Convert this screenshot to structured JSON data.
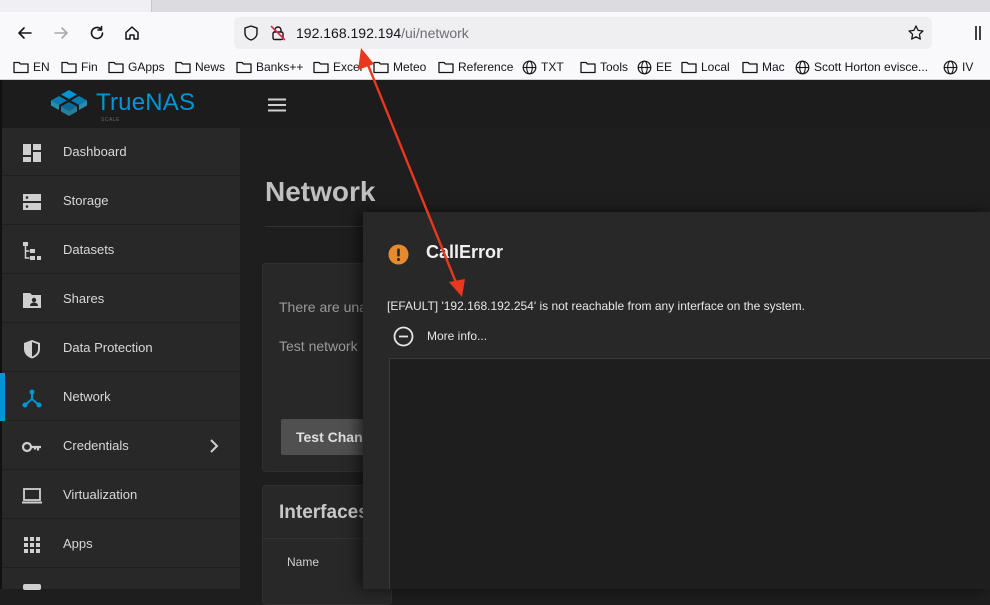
{
  "browser": {
    "url_host": "192.168.192.194",
    "url_path": "/ui/network",
    "bookmarks": [
      {
        "label": "EN",
        "icon": "folder-icon"
      },
      {
        "label": "Fin",
        "icon": "folder-icon"
      },
      {
        "label": "GApps",
        "icon": "folder-icon"
      },
      {
        "label": "News",
        "icon": "folder-icon"
      },
      {
        "label": "Banks++",
        "icon": "folder-icon"
      },
      {
        "label": "Excel",
        "icon": "folder-icon"
      },
      {
        "label": "Meteo",
        "icon": "folder-icon"
      },
      {
        "label": "Reference",
        "icon": "folder-icon"
      },
      {
        "label": "TXT",
        "icon": "globe-icon"
      },
      {
        "label": "Tools",
        "icon": "folder-icon"
      },
      {
        "label": "EE",
        "icon": "globe-icon"
      },
      {
        "label": "Local",
        "icon": "folder-icon"
      },
      {
        "label": "Mac",
        "icon": "folder-icon"
      },
      {
        "label": "Scott Horton evisce...",
        "icon": "globe-icon"
      },
      {
        "label": "IV",
        "icon": "globe-icon"
      }
    ]
  },
  "app": {
    "logo_text": "TrueNAS",
    "logo_sub": "SCALE",
    "accent": "#0095d5"
  },
  "sidebar": {
    "items": [
      {
        "label": "Dashboard",
        "icon": "dashboard-icon"
      },
      {
        "label": "Storage",
        "icon": "storage-icon"
      },
      {
        "label": "Datasets",
        "icon": "datasets-icon"
      },
      {
        "label": "Shares",
        "icon": "shares-folder-icon"
      },
      {
        "label": "Data Protection",
        "icon": "shield-icon"
      },
      {
        "label": "Network",
        "icon": "network-icon",
        "active": true
      },
      {
        "label": "Credentials",
        "icon": "key-icon"
      },
      {
        "label": "Virtualization",
        "icon": "laptop-icon"
      },
      {
        "label": "Apps",
        "icon": "apps-grid-icon"
      }
    ]
  },
  "main": {
    "page_title": "Network",
    "card_text_1": "There are una",
    "card_text_2": "Test network",
    "test_button_label": "Test Chan",
    "interfaces_title": "Interfaces",
    "interfaces_col_name": "Name"
  },
  "dialog": {
    "title": "CallError",
    "message": "[EFAULT] '192.168.192.254' is not reachable from any interface on the system.",
    "more_info": "More info...",
    "warning_color": "#e68a2e"
  },
  "annotation": {
    "arrow_color": "#e8381f"
  }
}
